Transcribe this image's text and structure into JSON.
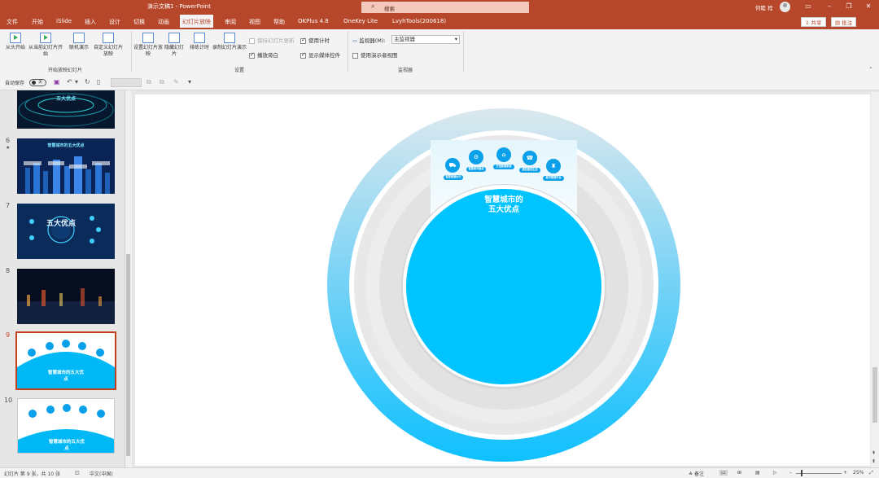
{
  "window": {
    "title": "演示文稿1 - PowerPoint",
    "search_placeholder": "搜索",
    "user_name": "何睦 程"
  },
  "menu": {
    "items": [
      "文件",
      "开始",
      "iSlide",
      "插入",
      "设计",
      "切换",
      "动画",
      "幻灯片放映",
      "审阅",
      "视图",
      "帮助",
      "OKPlus 4.8",
      "OneKey Lite",
      "LvyhTools(200618)"
    ],
    "active": "幻灯片放映",
    "share_label": "共享",
    "comment_label": "批注"
  },
  "ribbon": {
    "start_group": {
      "label": "开始放映幻灯片",
      "buttons": [
        "从头开始",
        "从当前幻灯片开始",
        "联机演示",
        "自定义幻灯片放映"
      ]
    },
    "setup_group": {
      "label": "设置",
      "buttons": [
        "设置幻灯片放映",
        "隐藏幻灯片",
        "排练计时",
        "录制幻灯片演示"
      ],
      "options": [
        {
          "label": "保持幻灯片更新",
          "checked": false,
          "disabled": true
        },
        {
          "label": "播放旁白",
          "checked": true,
          "disabled": false
        },
        {
          "label": "使用计时",
          "checked": true,
          "disabled": false
        },
        {
          "label": "显示媒体控件",
          "checked": true,
          "disabled": false
        }
      ]
    },
    "monitor_group": {
      "label": "监视器",
      "monitor_label": "监视器(M):",
      "monitor_value": "主监视器",
      "presenter_view_label": "使用演示者视图",
      "presenter_view_checked": false
    }
  },
  "qat": {
    "autosave_label": "自动保存",
    "autosave_state": "关"
  },
  "thumbnails": [
    {
      "number": "6",
      "starred": true,
      "text": "智慧城市的五大优点",
      "style": "dark"
    },
    {
      "number": "7",
      "starred": false,
      "text": "五大优点",
      "style": "dark"
    },
    {
      "number": "8",
      "starred": false,
      "text": "",
      "style": "dark"
    },
    {
      "number": "9",
      "starred": false,
      "text": "智慧城市的五大优点",
      "style": "light",
      "selected": true
    },
    {
      "number": "10",
      "starred": false,
      "text": "智慧城市的五大优点",
      "style": "light"
    }
  ],
  "top_thumb_text": "五大优点",
  "slide": {
    "title_line1": "智慧城市的",
    "title_line2": "五大优点",
    "icon_labels": [
      "智慧便捷出行",
      "智慧城市建设",
      "打造智慧家居",
      "便民服务生活",
      "城市管理平台"
    ],
    "icon_names": [
      "car-icon",
      "hand-gear-icon",
      "house-icon",
      "service-icon",
      "city-icon"
    ]
  },
  "status": {
    "slide_info": "幻灯片 第 9 张，共 10 张",
    "language": "中文(中国)",
    "notes_label": "备注",
    "zoom": "25%"
  },
  "colors": {
    "brand": "#b7472a",
    "ring_outer": "#1fb8f0",
    "circle_fill": "#00c4ff",
    "selected_thumb": "#c43e1c"
  }
}
